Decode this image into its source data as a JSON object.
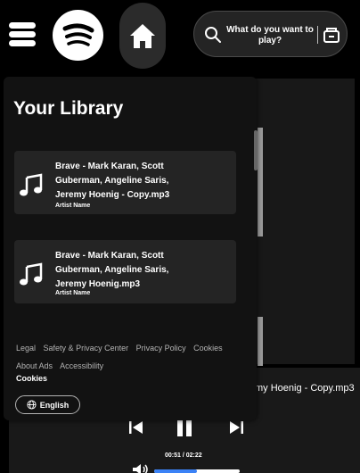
{
  "header": {
    "search_placeholder": "What do you want to play?"
  },
  "library": {
    "title": "Your Library",
    "items": [
      {
        "title": "Brave - Mark Karan, Scott Guberman, Angeline Saris, Jeremy Hoenig - Copy.mp3",
        "artist": "Artist Name"
      },
      {
        "title": "Brave - Mark Karan, Scott Guberman, Angeline Saris, Jeremy Hoenig.mp3",
        "artist": "Artist Name"
      }
    ],
    "footer_links": [
      "Legal",
      "Safety & Privacy Center",
      "Privacy Policy",
      "Cookies",
      "About Ads",
      "Accessibility"
    ],
    "cookies_label": "Cookies",
    "language_label": "English"
  },
  "player": {
    "now_playing": "my Hoenig - Copy.mp3",
    "time": "00:51 / 02:22",
    "volume_fraction": 0.5
  },
  "colors": {
    "background": "#000000",
    "panel": "#121212",
    "card": "#242424",
    "accent": "#3b82f6"
  }
}
